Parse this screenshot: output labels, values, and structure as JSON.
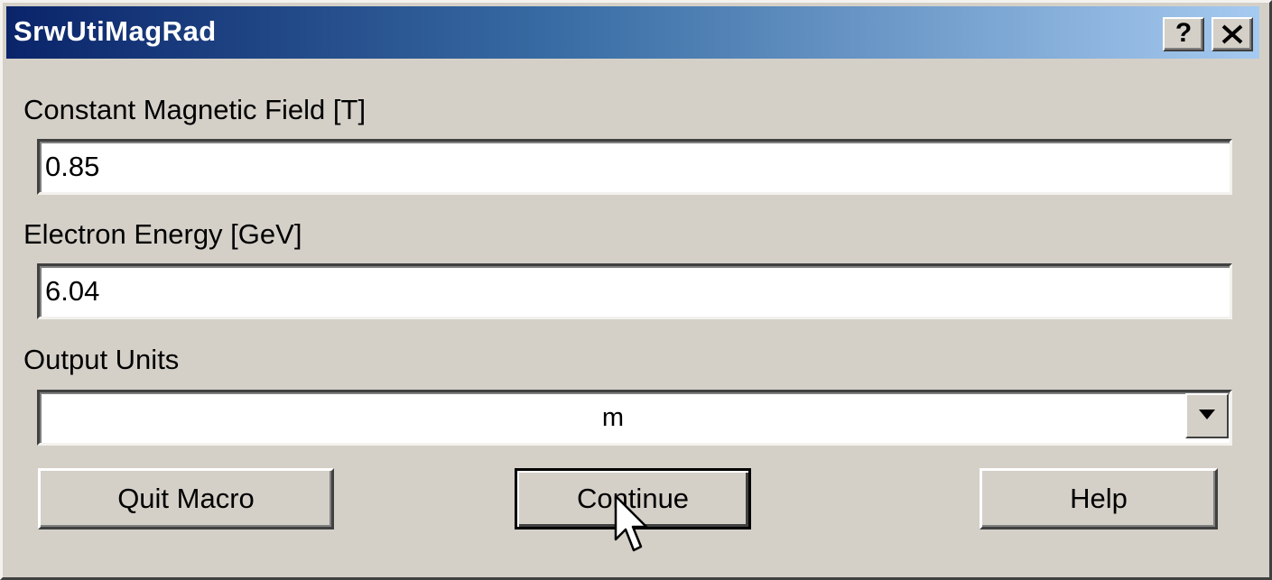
{
  "window": {
    "title": "SrwUtiMagRad",
    "help_button": "?"
  },
  "form": {
    "field_label": "Constant Magnetic Field [T]",
    "field_value": "0.85",
    "energy_label": "Electron Energy [GeV]",
    "energy_value": "6.04",
    "units_label": "Output Units",
    "units_value": "m"
  },
  "buttons": {
    "quit": "Quit Macro",
    "continue": "Continue",
    "help": "Help"
  },
  "icons": [
    "close-icon",
    "dropdown-arrow-icon",
    "mouse-cursor-icon"
  ]
}
